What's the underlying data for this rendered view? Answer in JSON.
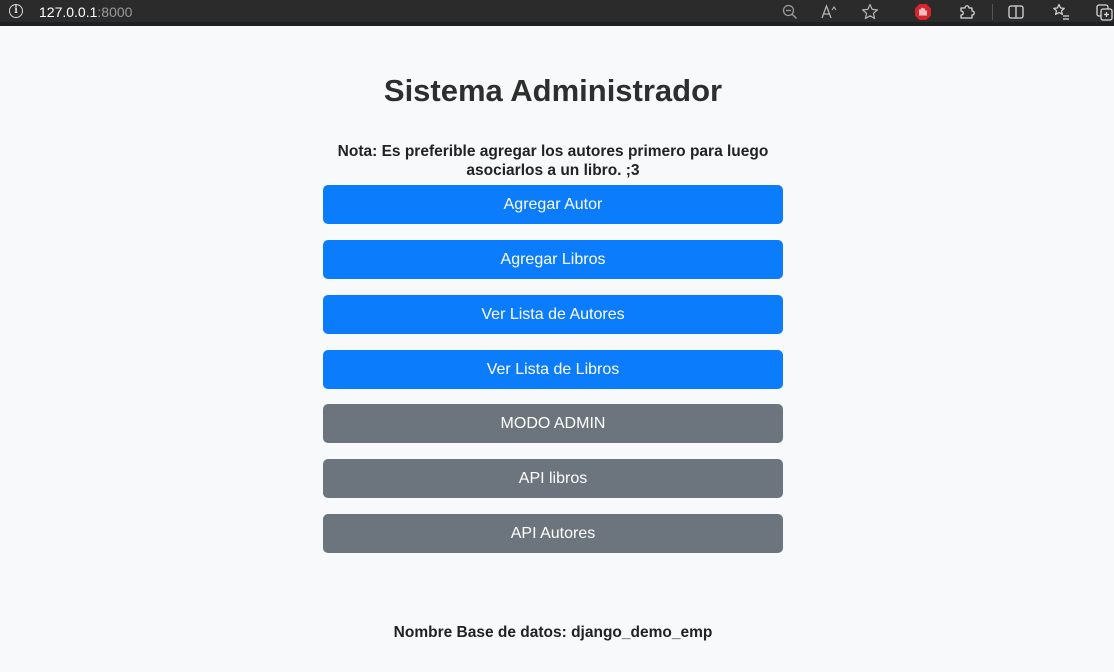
{
  "browser": {
    "url_host": "127.0.0.1",
    "url_port": ":8000",
    "icons": [
      "info-icon",
      "zoom-out-icon",
      "read-aloud-icon",
      "favorite-star-icon",
      "extension-red-icon",
      "extensions-puzzle-icon",
      "split-screen-icon",
      "favorites-list-icon",
      "collections-icon"
    ]
  },
  "page": {
    "title": "Sistema Administrador",
    "note": "Nota: Es preferible agregar los autores primero para luego asociarlos a un libro. ;3",
    "buttons": [
      {
        "label": "Agregar Autor",
        "style": "primary"
      },
      {
        "label": "Agregar Libros",
        "style": "primary"
      },
      {
        "label": "Ver Lista de Autores",
        "style": "primary"
      },
      {
        "label": "Ver Lista de Libros",
        "style": "primary"
      },
      {
        "label": "MODO ADMIN",
        "style": "secondary"
      },
      {
        "label": "API libros",
        "style": "secondary"
      },
      {
        "label": "API Autores",
        "style": "secondary"
      }
    ],
    "footer": "Nombre Base de datos: django_demo_emp"
  },
  "colors": {
    "primary": "#0a7cfc",
    "secondary": "#6c757d",
    "background": "#f8f9fa"
  }
}
